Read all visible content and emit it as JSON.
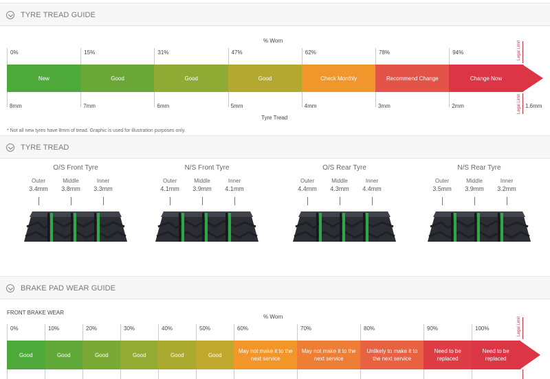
{
  "sections": {
    "tread_guide": "TYRE TREAD GUIDE",
    "tyre_tread": "TYRE TREAD",
    "brake_guide": "BRAKE PAD WEAR GUIDE"
  },
  "tread_guide": {
    "top_axis_title": "% Worn",
    "bottom_axis_title": "Tyre Tread",
    "legal_limit": "Legal Limit",
    "percent_ticks": [
      "0%",
      "15%",
      "31%",
      "47%",
      "62%",
      "78%",
      "94%"
    ],
    "mm_ticks": [
      "8mm",
      "7mm",
      "6mm",
      "5mm",
      "4mm",
      "3mm",
      "2mm"
    ],
    "end_mm": "1.6mm",
    "segments": [
      {
        "label": "New",
        "color": "#4ea93b"
      },
      {
        "label": "Good",
        "color": "#6aa736"
      },
      {
        "label": "Good",
        "color": "#8fab33"
      },
      {
        "label": "Good",
        "color": "#b3a930"
      },
      {
        "label": "Check Monthly",
        "color": "#f0962a"
      },
      {
        "label": "Recommend Change",
        "color": "#e35348"
      },
      {
        "label": "Change Now",
        "color": "#dc3545"
      }
    ],
    "footnote": "* Not all new tyres have 8mm of tread. Graphic is used for illustration purposes only."
  },
  "tyres": [
    {
      "name": "O/S Front Tyre",
      "outer": "3.4mm",
      "middle": "3.8mm",
      "inner": "3.3mm"
    },
    {
      "name": "N/S Front Tyre",
      "outer": "4.1mm",
      "middle": "3.9mm",
      "inner": "4.1mm"
    },
    {
      "name": "O/S Rear Tyre",
      "outer": "4.4mm",
      "middle": "4.3mm",
      "inner": "4.4mm"
    },
    {
      "name": "N/S Rear Tyre",
      "outer": "3.5mm",
      "middle": "3.9mm",
      "inner": "3.2mm"
    }
  ],
  "tyre_positions": {
    "outer": "Outer",
    "middle": "Middle",
    "inner": "Inner"
  },
  "brake_guide": {
    "subtitle": "FRONT BRAKE WEAR",
    "top_axis_title": "% Worn",
    "legal_limit": "Legal Limit",
    "percent_ticks": [
      "0%",
      "10%",
      "20%",
      "30%",
      "40%",
      "50%",
      "60%",
      "70%",
      "80%",
      "90%",
      "100%"
    ],
    "segments": [
      {
        "label": "Good",
        "color": "#4ea93b"
      },
      {
        "label": "Good",
        "color": "#62a838"
      },
      {
        "label": "Good",
        "color": "#7aa935"
      },
      {
        "label": "Good",
        "color": "#93aa33"
      },
      {
        "label": "Good",
        "color": "#aaa930"
      },
      {
        "label": "Good",
        "color": "#c0a72e"
      },
      {
        "label": "May not make it to the next service",
        "color": "#f2962a"
      },
      {
        "label": "May not make it to the next service",
        "color": "#ee7d35"
      },
      {
        "label": "Unlikely to make it to the next service",
        "color": "#e86242"
      },
      {
        "label": "Need to be replaced",
        "color": "#de3d46"
      },
      {
        "label": "Need to be replaced",
        "color": "#dc3545"
      }
    ]
  }
}
